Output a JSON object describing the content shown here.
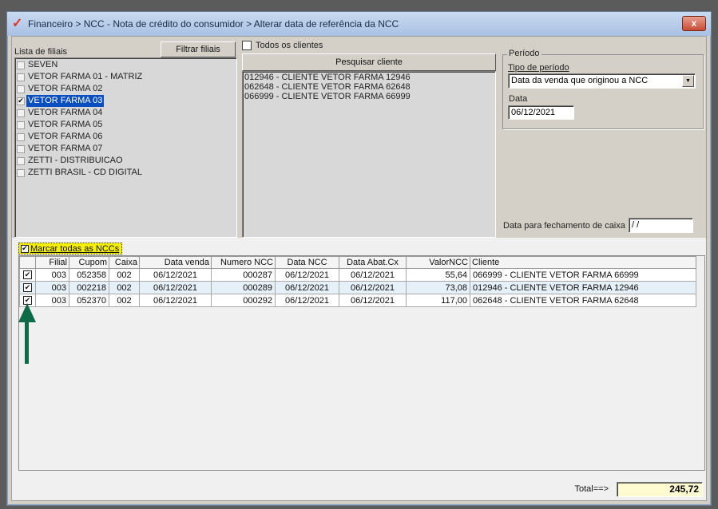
{
  "window": {
    "title": "Financeiro > NCC - Nota de crédito do consumidor > Alterar data de referência da NCC",
    "close_glyph": "x"
  },
  "filiais": {
    "label": "Lista de filiais",
    "filter_button": "Filtrar filiais",
    "items": [
      {
        "label": "SEVEN",
        "checked": false,
        "selected": false
      },
      {
        "label": "VETOR FARMA 01 - MATRIZ",
        "checked": false,
        "selected": false
      },
      {
        "label": "VETOR FARMA 02",
        "checked": false,
        "selected": false
      },
      {
        "label": "VETOR FARMA 03",
        "checked": true,
        "selected": true
      },
      {
        "label": "VETOR FARMA 04",
        "checked": false,
        "selected": false
      },
      {
        "label": "VETOR FARMA 05",
        "checked": false,
        "selected": false
      },
      {
        "label": "VETOR FARMA 06",
        "checked": false,
        "selected": false
      },
      {
        "label": "VETOR FARMA 07",
        "checked": false,
        "selected": false
      },
      {
        "label": "ZETTI - DISTRIBUICAO",
        "checked": false,
        "selected": false
      },
      {
        "label": "ZETTI BRASIL - CD DIGITAL",
        "checked": false,
        "selected": false
      }
    ]
  },
  "clientes": {
    "all_label": "Todos os clientes",
    "all_checked": false,
    "search_button": "Pesquisar cliente",
    "items": [
      "012946 - CLIENTE VETOR FARMA 12946",
      "062648 - CLIENTE VETOR FARMA 62648",
      "066999 - CLIENTE VETOR FARMA 66999"
    ]
  },
  "periodo": {
    "title": "Período",
    "tipo_label": "Tipo de período",
    "tipo_value": "Data da venda que originou a NCC",
    "data_label": "Data",
    "data_value": "06/12/2021",
    "fechamento_label": "Data para fechamento de caixa",
    "fechamento_value": " / /"
  },
  "grid": {
    "mark_all_label": "Marcar todas as NCCs",
    "mark_all_checked": true,
    "check_glyph": "✔",
    "columns": [
      "",
      "Filial",
      "Cupom",
      "Caixa",
      "Data venda",
      "Numero NCC",
      "Data NCC",
      "Data Abat.Cx",
      "ValorNCC",
      "Cliente"
    ],
    "rows": [
      {
        "checked": true,
        "filial": "003",
        "cupom": "052358",
        "caixa": "002",
        "data_venda": "06/12/2021",
        "numero_ncc": "000287",
        "data_ncc": "06/12/2021",
        "data_abat": "06/12/2021",
        "valor": "55,64",
        "cliente": "066999 - CLIENTE VETOR FARMA 66999"
      },
      {
        "checked": true,
        "filial": "003",
        "cupom": "002218",
        "caixa": "002",
        "data_venda": "06/12/2021",
        "numero_ncc": "000289",
        "data_ncc": "06/12/2021",
        "data_abat": "06/12/2021",
        "valor": "73,08",
        "cliente": "012946 - CLIENTE VETOR FARMA 12946"
      },
      {
        "checked": true,
        "filial": "003",
        "cupom": "052370",
        "caixa": "002",
        "data_venda": "06/12/2021",
        "numero_ncc": "000292",
        "data_ncc": "06/12/2021",
        "data_abat": "06/12/2021",
        "valor": "117,00",
        "cliente": "062648 - CLIENTE VETOR FARMA 62648"
      }
    ]
  },
  "total": {
    "label": "Total==>",
    "value": "245,72"
  },
  "colors": {
    "highlight_yellow": "#f5f000",
    "selection_blue": "#0a4fbf",
    "annotation_arrow": "#0e6b4a"
  },
  "annotation": {
    "icon": "up-arrow-icon"
  }
}
